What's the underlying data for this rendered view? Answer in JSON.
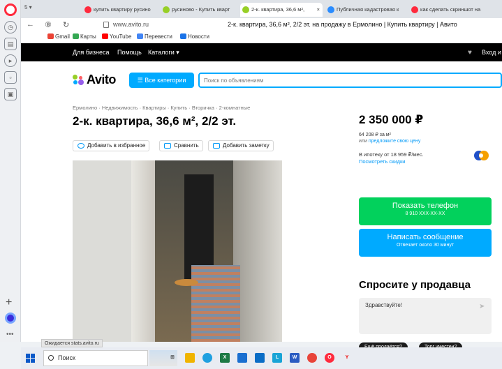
{
  "browser": {
    "tabs": [
      {
        "label": "купить квартиру русино",
        "icon_color": "#ff2a3d",
        "active": false
      },
      {
        "label": "русиново - Купить кварт",
        "icon_color": "#97cf26",
        "active": false
      },
      {
        "label": "2-к. квартира, 36,6 м², ",
        "icon_color": "#97cf26",
        "active": true
      },
      {
        "label": "Публичная кадастровая к",
        "icon_color": "#2a8cff",
        "active": false
      },
      {
        "label": "как сделать скриншот на",
        "icon_color": "#ff2a3d",
        "active": false
      }
    ],
    "tab_close": "×",
    "tab_counter": "5",
    "url": "www.avito.ru",
    "page_title": "2-к. квартира, 36,6 м², 2/2 эт. на продажу в Ермолино | Купить квартиру | Авито",
    "bookmarks": [
      {
        "label": "Gmail",
        "color": "#ea4335"
      },
      {
        "label": "Карты",
        "color": "#34a853"
      },
      {
        "label": "YouTube",
        "color": "#ff0000"
      },
      {
        "label": "Перевести",
        "color": "#4285f4"
      },
      {
        "label": "Новости",
        "color": "#1a73e8"
      }
    ],
    "status": "Ожидается stats.avito.ru"
  },
  "avito_nav": {
    "for_business": "Для бизнеса",
    "help": "Помощь",
    "catalogs": "Каталоги",
    "login": "Вход и"
  },
  "header": {
    "logo": "Avito",
    "all_categories": "Все категории",
    "search_placeholder": "Поиск по объявлениям"
  },
  "listing": {
    "breadcrumbs": "Ермолино · Недвижимость · Квартиры · Купить · Вторичка · 2-комнатные",
    "title": "2-к. квартира, 36,6 м², 2/2 эт.",
    "actions": {
      "favorite": "Добавить в избранное",
      "compare": "Сравнить",
      "note": "Добавить заметку"
    },
    "price": "2 350 000 ₽",
    "price_per_m2": "64 208 ₽ за м²",
    "offer_prefix": "или",
    "offer_link": "предложите свою цену",
    "mortgage": "В ипотеку от 18 959 ₽/мес.",
    "discounts": "Посмотреть скидки",
    "phone_button": "Показать телефон",
    "phone_number": "8 910 XXX-XX-XX",
    "message_button": "Написать сообщение",
    "message_sub": "Отвечает около 30 минут",
    "ask_title": "Спросите у продавца",
    "message_text": "Здравствуйте!",
    "chips": [
      "Ещё продаётся?",
      "Торг уместен?"
    ]
  },
  "taskbar": {
    "search": "Поиск"
  },
  "colors": {
    "accent": "#00aaff",
    "phone_green": "#02d15c",
    "message_blue": "#00aaff"
  }
}
